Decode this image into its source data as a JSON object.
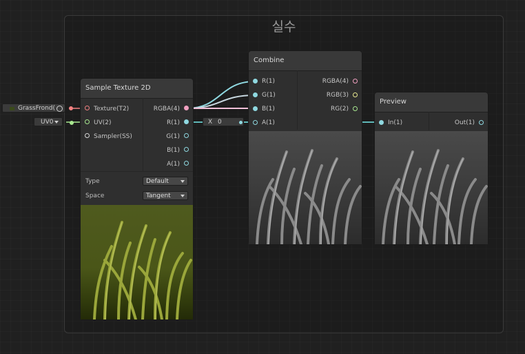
{
  "group": {
    "title": "실수"
  },
  "sample_texture": {
    "title": "Sample Texture 2D",
    "inputs": [
      "Texture(T2)",
      "UV(2)",
      "Sampler(SS)"
    ],
    "outputs": [
      "RGBA(4)",
      "R(1)",
      "G(1)",
      "B(1)",
      "A(1)"
    ],
    "props": {
      "type_label": "Type",
      "type_value": "Default",
      "space_label": "Space",
      "space_value": "Tangent"
    }
  },
  "texture_input": {
    "value": "GrassFrond("
  },
  "uv_input": {
    "value": "UV0"
  },
  "combine": {
    "title": "Combine",
    "inputs": [
      "R(1)",
      "G(1)",
      "B(1)",
      "A(1)"
    ],
    "outputs": [
      "RGBA(4)",
      "RGB(3)",
      "RG(2)"
    ],
    "a_field": {
      "label": "X",
      "value": "0"
    }
  },
  "preview": {
    "title": "Preview",
    "inputs": [
      "In(1)"
    ],
    "outputs": [
      "Out(1)"
    ]
  },
  "colors": {
    "wire_float": "#8fd8e0",
    "wire_vector4": "#f0a0c0",
    "canvas": "#202020",
    "node": "#2f2f2f"
  },
  "icons": [
    "target-icon",
    "dropdown-arrow-icon"
  ]
}
